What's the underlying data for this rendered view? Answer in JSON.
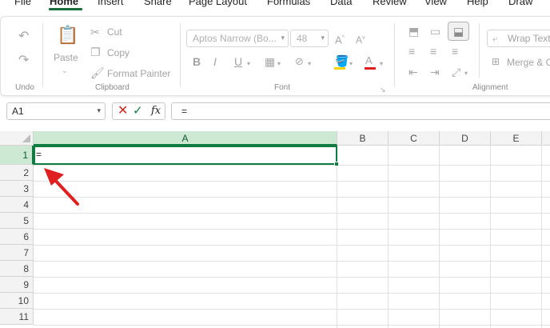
{
  "menu": {
    "tabs": [
      {
        "label": "File"
      },
      {
        "label": "Home"
      },
      {
        "label": "Insert"
      },
      {
        "label": "Share"
      },
      {
        "label": "Page Layout"
      },
      {
        "label": "Formulas"
      },
      {
        "label": "Data"
      },
      {
        "label": "Review"
      },
      {
        "label": "View"
      },
      {
        "label": "Help"
      },
      {
        "label": "Draw"
      }
    ],
    "active": "Home"
  },
  "ribbon": {
    "undo_group": {
      "label": "Undo",
      "undo_icon": "undo-icon",
      "redo_icon": "redo-icon"
    },
    "clipboard": {
      "label": "Clipboard",
      "paste": "Paste",
      "cut": "Cut",
      "copy": "Copy",
      "format_painter": "Format Painter"
    },
    "font": {
      "label": "Font",
      "font_name": "Aptos Narrow (Bo...",
      "font_size": "48",
      "bold": "B",
      "italic": "I",
      "underline": "U"
    },
    "alignment": {
      "label": "Alignment",
      "wrap_text": "Wrap Text",
      "merge": "Merge & C"
    }
  },
  "formula_bar": {
    "name_box": "A1",
    "fx": "fx",
    "formula": "="
  },
  "sheet": {
    "columns": [
      "A",
      "B",
      "C",
      "D",
      "E"
    ],
    "rows": [
      "1",
      "2",
      "3",
      "4",
      "5",
      "6",
      "7",
      "8",
      "9",
      "10",
      "11"
    ],
    "active_cell": "A1",
    "active_value": "="
  },
  "colors": {
    "accent": "#107c41",
    "selected_header": "#cde9d4",
    "annotation_arrow": "#e02020"
  }
}
